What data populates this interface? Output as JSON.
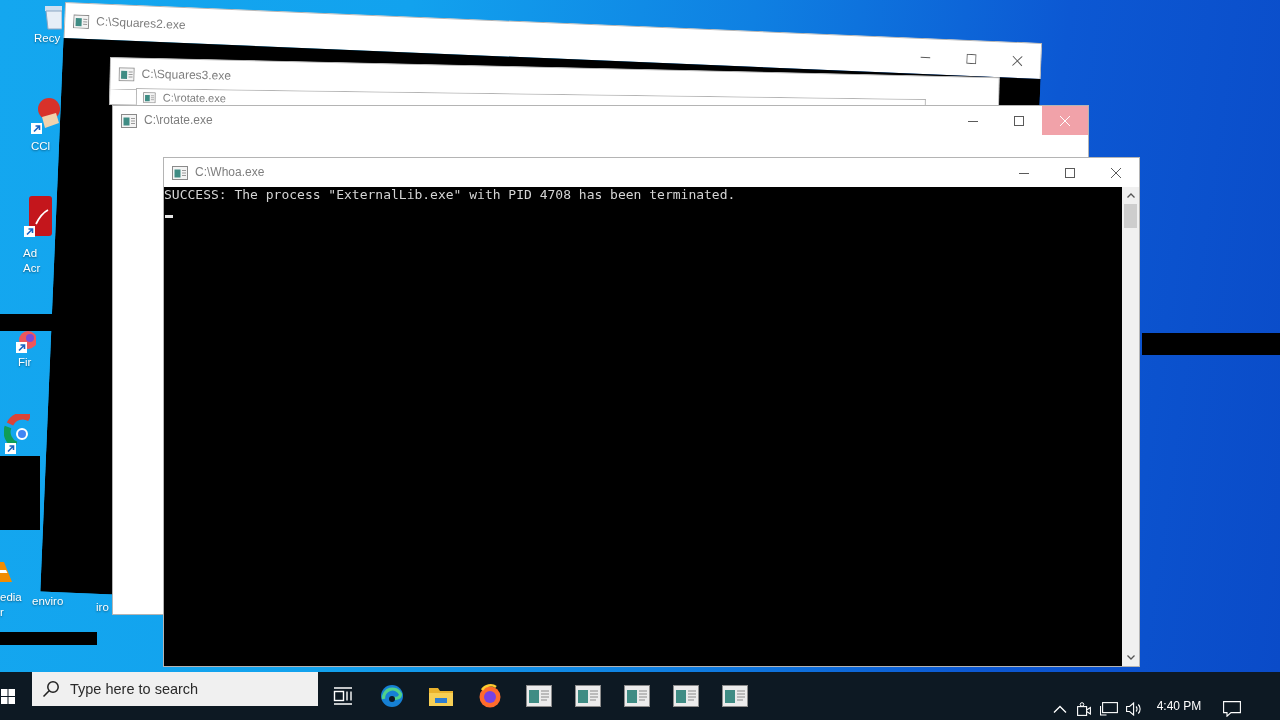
{
  "desktop_icons": [
    {
      "kind": "bin",
      "lines": [
        "Recy"
      ]
    },
    {
      "kind": "disc",
      "lines": [
        "CCl"
      ]
    },
    {
      "kind": "tile",
      "lines": [
        "Ad",
        "Acr"
      ]
    },
    {
      "kind": "fox",
      "lines": [
        "Fir"
      ]
    },
    {
      "kind": "ring"
    },
    {
      "kind": "cone",
      "lines": [
        "edia",
        "r"
      ]
    },
    {
      "kind": "text",
      "lines": [
        "enviro"
      ]
    },
    {
      "kind": "text",
      "lines": [
        "iro"
      ]
    }
  ],
  "windows": [
    {
      "title": "C:\\Squares2.exe",
      "kind": "dark"
    },
    {
      "title": "C:\\Squares3.exe",
      "kind": "strip"
    },
    {
      "title": "C:\\rotate.exe",
      "kind": "strip"
    },
    {
      "title": "C:\\rotate.exe",
      "kind": "light",
      "close_hover": true
    },
    {
      "title": "C:\\Whoa.exe",
      "kind": "console",
      "close_hover": false,
      "lines": [
        "SUCCESS: The process \"ExternalLib.exe\" with PID 4708 has been terminated."
      ]
    }
  ],
  "taskbar": {
    "search": {
      "placeholder": "Type here to search"
    },
    "clock": "4:40 PM"
  }
}
